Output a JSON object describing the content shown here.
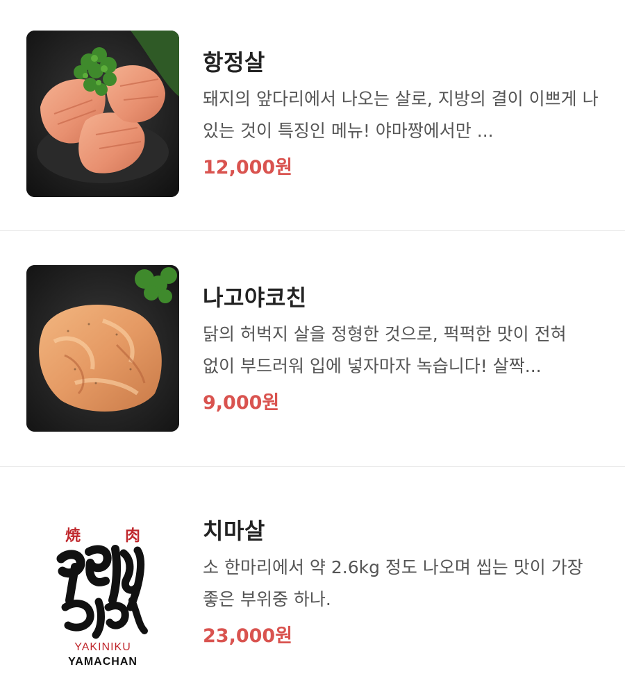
{
  "menu_items": [
    {
      "name": "항정살",
      "description": "돼지의 앞다리에서 나오는 살로, 지방의 결이 이쁘게 나 있는 것이 특징인 메뉴! 야마짱에서만 ...",
      "price": "12,000원",
      "image": "pork-jowl-photo"
    },
    {
      "name": "나고야코친",
      "description": "닭의 허벅지 살을 정형한 것으로, 퍽퍽한 맛이 전혀 없이 부드러워 입에 넣자마자 녹습니다! 살짝...",
      "price": "9,000원",
      "image": "chicken-thigh-photo"
    },
    {
      "name": "치마살",
      "description": "소 한마리에서 약 2.6kg 정도 나오며 씹는 맛이 가장 좋은 부위중 하나.",
      "price": "23,000원",
      "image": "yamachan-logo"
    }
  ],
  "logo": {
    "kanji_left": "焼",
    "kanji_right": "肉",
    "brand_script": "やまちゃん",
    "line1": "YAKINIKU",
    "line2": "YAMACHAN"
  },
  "colors": {
    "price": "#d9534f",
    "name": "#222222",
    "description": "#555555",
    "divider": "#e6e6e6",
    "logo_red": "#c0282d"
  }
}
